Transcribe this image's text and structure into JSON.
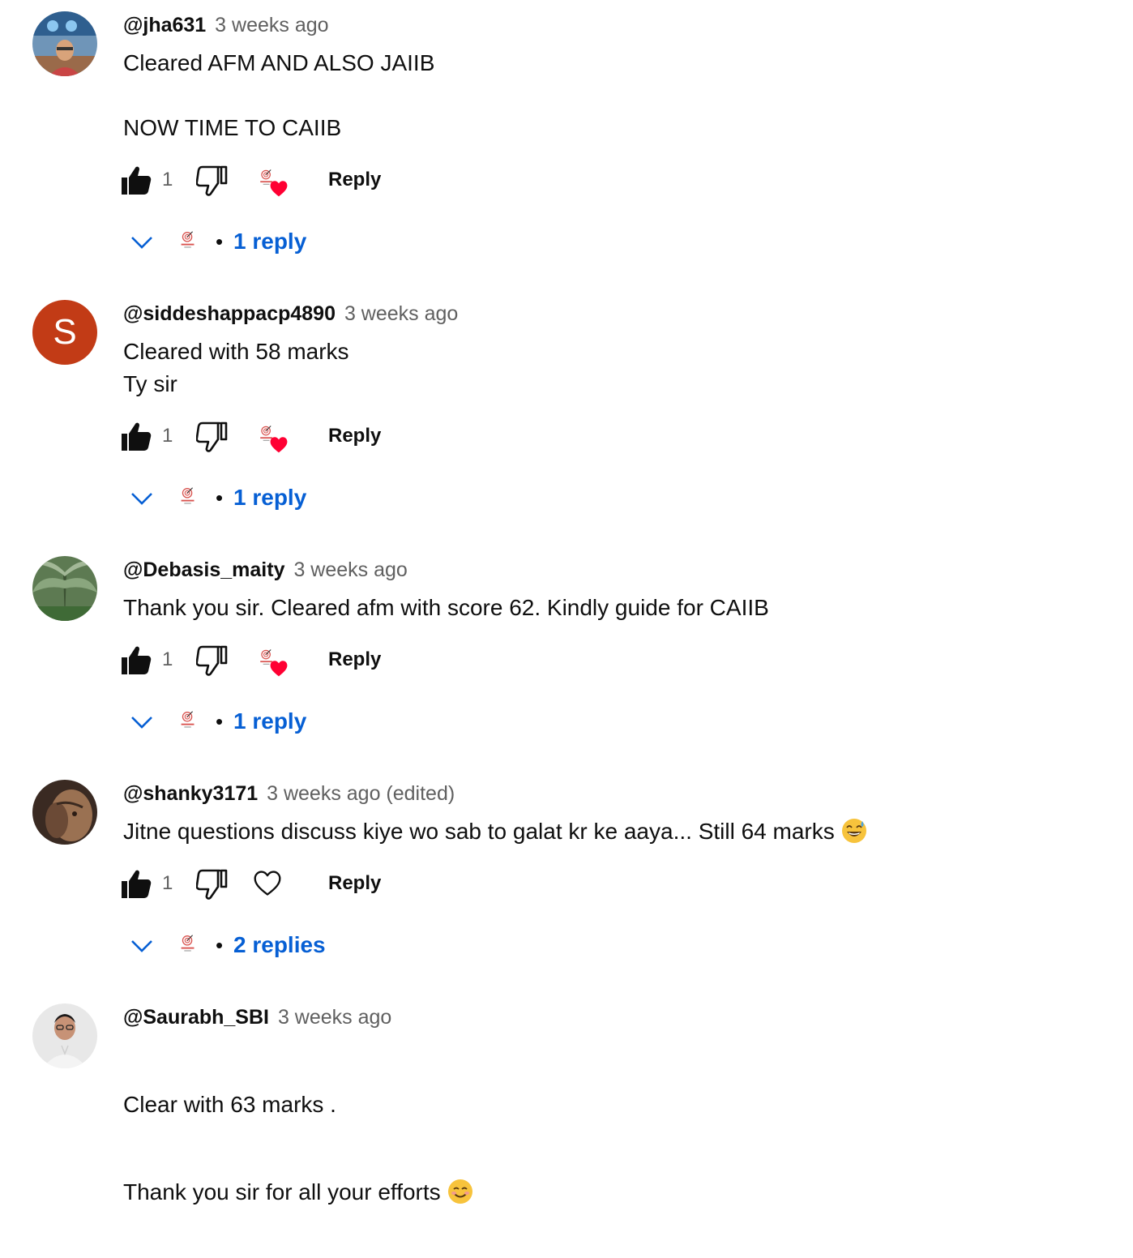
{
  "comments": [
    {
      "author": "@jha631",
      "time": "3 weeks ago",
      "text": "Cleared AFM AND ALSO JAIIB\n\nNOW TIME TO CAIIB",
      "likes": "1",
      "reply_label": "Reply",
      "creator_hearted": true,
      "replies_label": "1 reply",
      "avatar_icon": "user-photo-avatar"
    },
    {
      "author": "@siddeshappacp4890",
      "time": "3 weeks ago",
      "text": "Cleared with 58 marks\nTy sir",
      "likes": "1",
      "reply_label": "Reply",
      "creator_hearted": true,
      "replies_label": "1 reply",
      "avatar_letter": "S",
      "avatar_color": "#c23b16"
    },
    {
      "author": "@Debasis_maity",
      "time": "3 weeks ago",
      "text": "Thank you sir. Cleared afm with score 62. Kindly guide for CAIIB",
      "likes": "1",
      "reply_label": "Reply",
      "creator_hearted": true,
      "replies_label": "1 reply",
      "avatar_icon": "plant-photo-avatar"
    },
    {
      "author": "@shanky3171",
      "time": "3 weeks ago (edited)",
      "text": "Jitne questions discuss kiye wo sab to galat kr ke aaya... Still 64 marks",
      "emoji": "grinning-sweat-emoji",
      "likes": "1",
      "reply_label": "Reply",
      "creator_hearted": false,
      "replies_label": "2 replies",
      "avatar_icon": "face-photo-avatar"
    },
    {
      "author": "@Saurabh_SBI",
      "time": "3 weeks ago",
      "text_line1": "Clear with 63 marks .",
      "text_line2": "Thank you sir for all your efforts",
      "emoji": "smiling-emoji",
      "avatar_icon": "portrait-photo-avatar"
    }
  ],
  "colors": {
    "link": "#065fd4",
    "secondary_text": "#606060",
    "heart": "#ff0033"
  }
}
